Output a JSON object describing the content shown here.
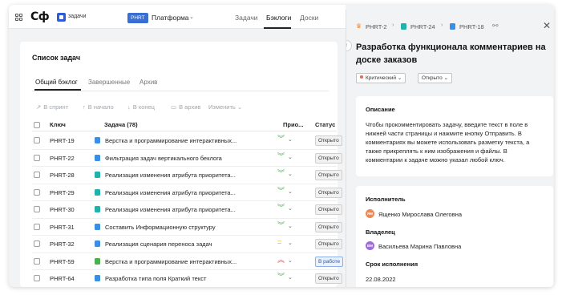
{
  "topbar": {
    "logo": "Сф",
    "app_label": "задачи",
    "project_key": "PHRT",
    "project_name": "Платформа",
    "tabs": [
      "Задачи",
      "Бэклоги",
      "Доски"
    ]
  },
  "backlog": {
    "title": "Список задач",
    "subtabs": [
      "Общий бэклог",
      "Завершенные",
      "Архив"
    ],
    "actions": [
      "В спринт",
      "В начало",
      "В конец",
      "В архив",
      "Изменить"
    ],
    "columns": {
      "key": "Ключ",
      "task": "Задача (78)",
      "priority": "Прио...",
      "status": "Статус"
    },
    "rows": [
      {
        "key": "PHRT-19",
        "title": "Верстка и программирование интерактивных...",
        "type": "task",
        "priority": "low",
        "status": "Открыто"
      },
      {
        "key": "PHRT-22",
        "title": "Фильтрация задач вертикального беклога",
        "type": "task",
        "priority": "low",
        "status": "Открыто"
      },
      {
        "key": "PHRT-28",
        "title": "Реализация изменения атрибута приоритета...",
        "type": "story",
        "priority": "low",
        "status": "Открыто"
      },
      {
        "key": "PHRT-29",
        "title": "Реализация изменения атрибута приоритета...",
        "type": "story",
        "priority": "low",
        "status": "Открыто"
      },
      {
        "key": "PHRT-30",
        "title": "Реализация изменения атрибута приоритета...",
        "type": "story",
        "priority": "low",
        "status": "Открыто"
      },
      {
        "key": "PHRT-31",
        "title": "Составить  Информационную структуру",
        "type": "task",
        "priority": "low",
        "status": "Открыто"
      },
      {
        "key": "PHRT-32",
        "title": "Реализация сценария переноса задач",
        "type": "task",
        "priority": "medium",
        "status": "Открыто"
      },
      {
        "key": "PHRT-59",
        "title": "Верстка и программирование интерактивных...",
        "type": "feature",
        "priority": "high",
        "status": "В работе"
      },
      {
        "key": "PHRT-64",
        "title": "Разработка типа поля Краткий текст",
        "type": "task",
        "priority": "low",
        "status": "Открыто"
      }
    ]
  },
  "detail": {
    "breadcrumbs": [
      "PHRT-2",
      "PHRT-24",
      "PHRT-18"
    ],
    "title": "Разработка функционала комментариев на доске заказов",
    "priority": "Критический",
    "status": "Открыто",
    "description_label": "Описание",
    "description": "Чтобы прокомментировать задачу, введите текст в поле в нижней части страницы и нажмите кнопку Отправить. В комментариях вы можете использовать разметку текста, а также прикреплять к ним изображения и файлы. В комментарии к задаче можно указал любой ключ.",
    "assignee_label": "Исполнитель",
    "assignee_initials": "ЯМ",
    "assignee": "Ященко Мирослава Олеговна",
    "owner_label": "Владелец",
    "owner_initials": "ВМ",
    "owner": "Васильева Марина Павловна",
    "due_label": "Срок исполнения",
    "due_date": "22.08.2022"
  },
  "colors": {
    "task": "#3a8ee6",
    "story": "#20b2aa",
    "feature": "#4caf50",
    "priority_low": "#4caf50",
    "priority_medium": "#e0b300",
    "priority_high": "#e5484d",
    "epic": "#f08c3c",
    "assignee_avatar": "#e88b5a",
    "owner_avatar": "#a06bd4"
  }
}
